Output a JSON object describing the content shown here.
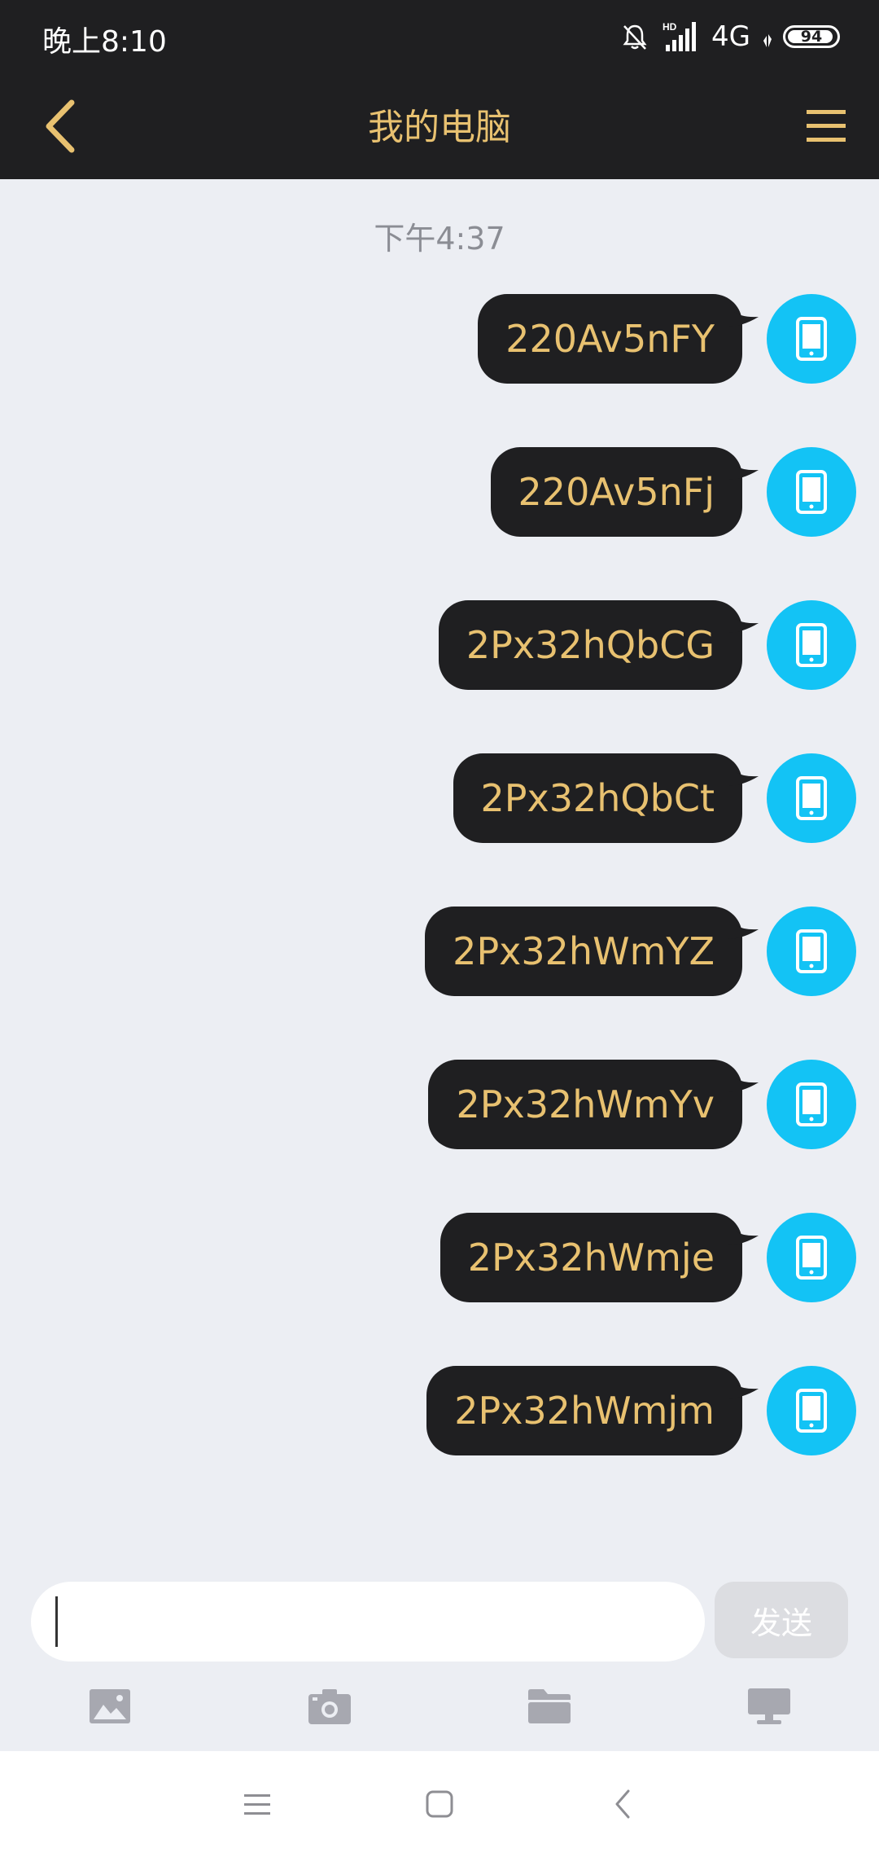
{
  "status_bar": {
    "time": "晚上8:10",
    "network": "4G",
    "battery_level": "94",
    "battery_fraction": 0.94,
    "icons": [
      "mute-bell-icon",
      "hd-signal-icon",
      "network-activity-icon",
      "battery-icon"
    ]
  },
  "header": {
    "title": "我的电脑",
    "back_icon": "chevron-left-icon",
    "menu_icon": "hamburger-menu-icon"
  },
  "chat": {
    "timestamp": "下午4:37",
    "messages": [
      {
        "text": "220Av5nFY"
      },
      {
        "text": "220Av5nFj"
      },
      {
        "text": "2Px32hQbCG"
      },
      {
        "text": "2Px32hQbCt"
      },
      {
        "text": "2Px32hWmYZ"
      },
      {
        "text": "2Px32hWmYv"
      },
      {
        "text": "2Px32hWmje"
      },
      {
        "text": "2Px32hWmjm"
      }
    ],
    "avatar_icon": "phone-icon"
  },
  "input": {
    "value": "",
    "send_label": "发送"
  },
  "toolbar": {
    "items": [
      "image-icon",
      "camera-icon",
      "folder-icon",
      "computer-icon"
    ]
  },
  "nav": {
    "items": [
      "menu-nav-icon",
      "home-nav-icon",
      "back-nav-icon"
    ]
  },
  "colors": {
    "header_bg": "#1f1f21",
    "accent_gold": "#e8c170",
    "chat_bg": "#eceef3",
    "avatar_blue": "#13c3f5",
    "timestamp_gray": "#8b8d94"
  }
}
